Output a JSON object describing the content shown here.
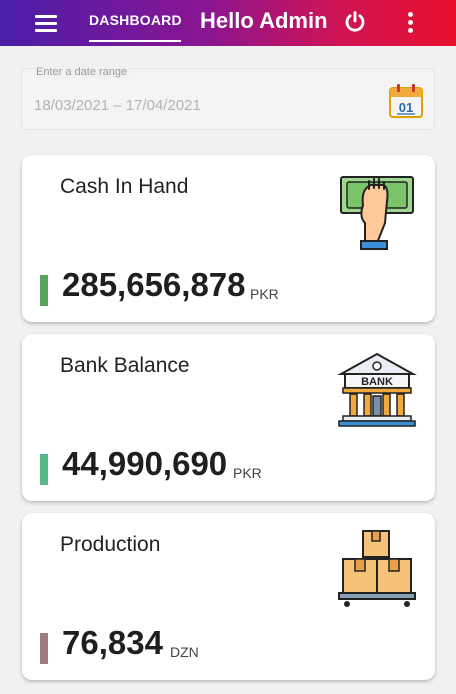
{
  "header": {
    "tab_label": "DASHBOARD",
    "greeting": "Hello Admin",
    "icons": [
      "menu-icon",
      "power-icon",
      "more-vert-icon"
    ]
  },
  "date_range": {
    "label": "Enter a date range",
    "value": "18/03/2021 – 17/04/2021",
    "icon": "calendar-icon",
    "calendar_day": "01"
  },
  "cards": [
    {
      "title": "Cash In Hand",
      "value": "285,656,878",
      "unit": "PKR",
      "bar_color": "#5aa35a",
      "icon": "cash-hand-icon"
    },
    {
      "title": "Bank Balance",
      "value": "44,990,690",
      "unit": "PKR",
      "bar_color": "#55b98a",
      "icon": "bank-icon",
      "icon_text": "BANK"
    },
    {
      "title": "Production",
      "value": "76,834",
      "unit": "DZN",
      "bar_color": "#9f7c80",
      "icon": "boxes-icon"
    }
  ]
}
